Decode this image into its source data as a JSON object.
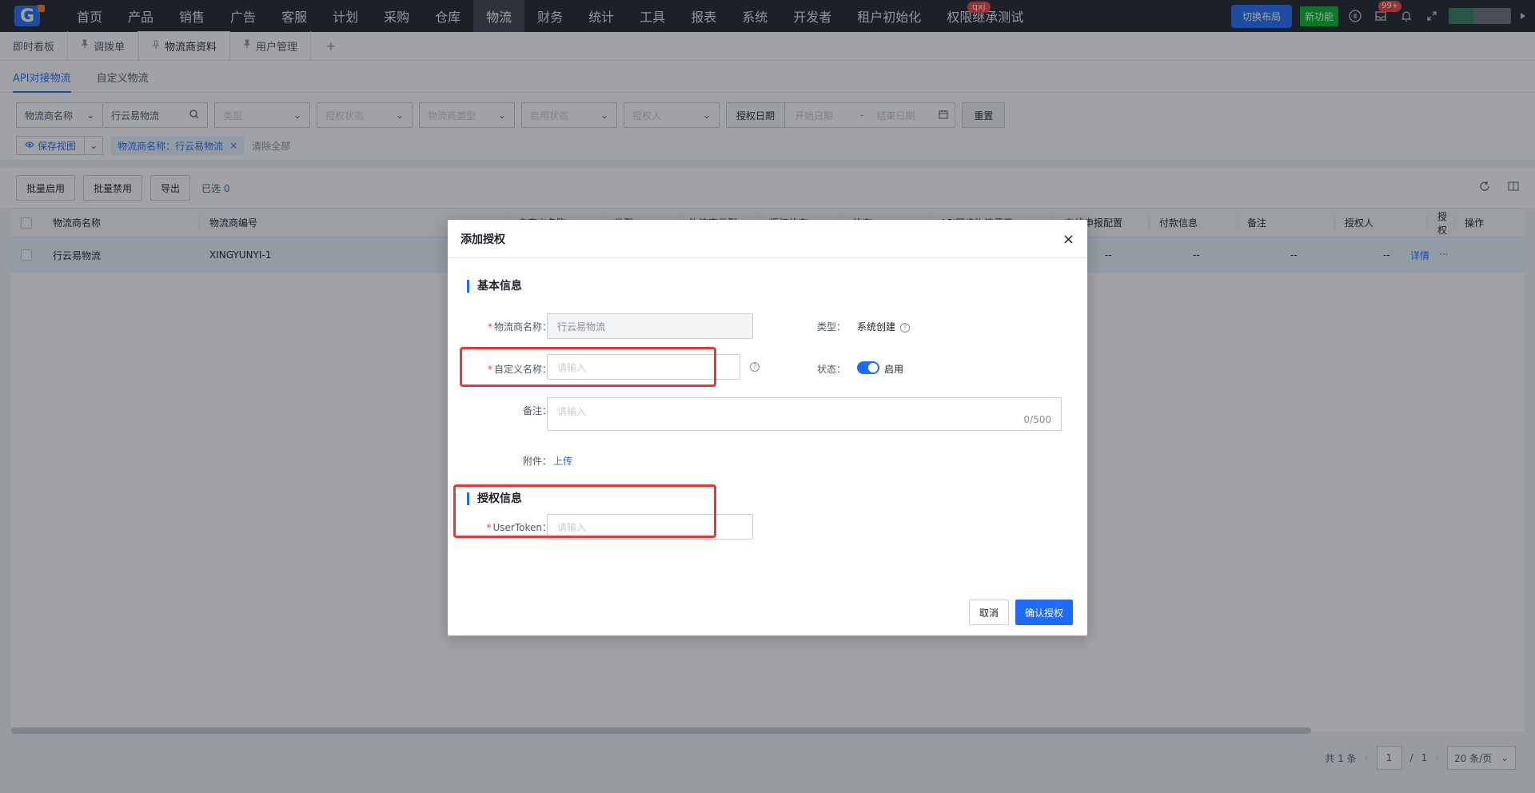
{
  "topnav": {
    "logo": "G",
    "items": [
      "首页",
      "产品",
      "销售",
      "广告",
      "客服",
      "计划",
      "采购",
      "仓库",
      "物流",
      "财务",
      "统计",
      "工具",
      "报表",
      "系统",
      "开发者",
      "租户初始化",
      "权限继承测试"
    ],
    "active_index": 8,
    "badge_qxj": "qxj",
    "switch_layout": "切换布局",
    "new_feature": "新功能",
    "notif_badge": "99+"
  },
  "tabs": {
    "items": [
      "即时看板",
      "调拨单",
      "物流商资料",
      "用户管理"
    ],
    "add": "+"
  },
  "subtabs": [
    "API对接物流",
    "自定义物流"
  ],
  "filters": {
    "name_select": "物流商名称",
    "name_value": "行云易物流",
    "type": "类型",
    "auth_status": "授权状态",
    "provider_type": "物流商类型",
    "enable_status": "启用状态",
    "authorizer": "授权人",
    "date_label": "授权日期",
    "start_date": "开始日期",
    "date_sep": "-",
    "end_date": "结束日期",
    "reset": "重置",
    "save_view": "保存视图",
    "chip": "物流商名称：行云易物流",
    "clear_all": "清除全部"
  },
  "toolbar": {
    "batch_enable": "批量启用",
    "batch_disable": "批量禁用",
    "export": "导出",
    "selected_label": "已选",
    "selected_count": "0"
  },
  "table": {
    "headers": [
      "物流商名称",
      "物流商编号",
      "自定义名称",
      "类型",
      "物流商类型",
      "授权状态",
      "状态",
      "API同步物流费用",
      "在线申报配置",
      "付款信息",
      "备注",
      "授权人",
      "授权",
      "操作"
    ],
    "row": {
      "name": "行云易物流",
      "code": "XINGYUNYI-1",
      "payment": "--",
      "remark": "--",
      "authorizer": "--",
      "auth": "--",
      "op_detail": "详情",
      "op_more": "···"
    }
  },
  "pager": {
    "total": "共 1 条",
    "page": "1",
    "sep": "/",
    "pages": "1",
    "page_size": "20 条/页"
  },
  "modal": {
    "title": "添加授权",
    "close": "×",
    "section_basic": "基本信息",
    "label_provider": "物流商名称：",
    "value_provider": "行云易物流",
    "label_custom": "自定义名称：",
    "ph_custom": "请输入",
    "label_type": "类型：",
    "value_type": "系统创建",
    "label_status": "状态：",
    "value_status": "启用",
    "label_remark": "备注：",
    "ph_remark": "请输入",
    "remark_count": "0/500",
    "label_attach": "附件：",
    "upload": "上传",
    "section_auth": "授权信息",
    "label_token": "UserToken：",
    "ph_token": "请输入",
    "cancel": "取消",
    "confirm": "确认授权"
  },
  "colors": {
    "primary": "#1f6bff",
    "required": "#f53f3f",
    "highlight": "#e53935",
    "nav_bg": "#1d2129",
    "new_badge": "#00b42a"
  }
}
